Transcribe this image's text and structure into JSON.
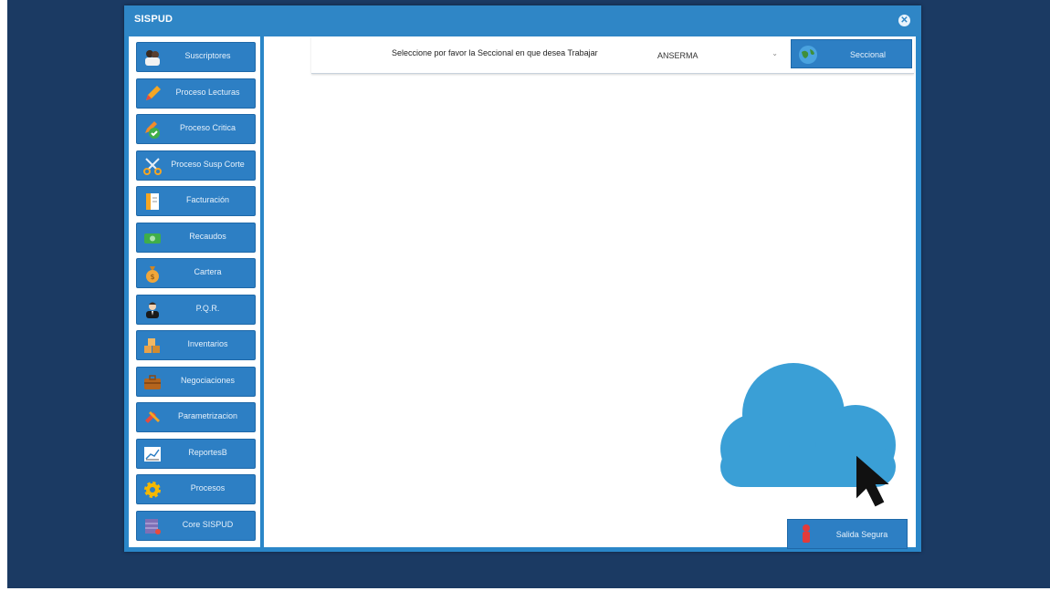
{
  "window": {
    "title": "SISPUD",
    "close_icon": "close-icon"
  },
  "sidebar": {
    "items": [
      {
        "label": "Suscriptores",
        "icon": "users-icon"
      },
      {
        "label": "Proceso Lecturas",
        "icon": "pencil-icon"
      },
      {
        "label": "Proceso Critica",
        "icon": "edit-check-icon"
      },
      {
        "label": "Proceso Susp Corte",
        "icon": "scissors-icon"
      },
      {
        "label": "Facturación",
        "icon": "invoice-icon"
      },
      {
        "label": "Recaudos",
        "icon": "cash-icon"
      },
      {
        "label": "Cartera",
        "icon": "money-bag-icon"
      },
      {
        "label": "P.Q.R.",
        "icon": "support-agent-icon"
      },
      {
        "label": "Inventarios",
        "icon": "boxes-icon"
      },
      {
        "label": "Negociaciones",
        "icon": "briefcase-icon"
      },
      {
        "label": "Parametrizacion",
        "icon": "tools-icon"
      },
      {
        "label": "ReportesB",
        "icon": "chart-icon"
      },
      {
        "label": "Procesos",
        "icon": "gear-icon"
      },
      {
        "label": "Core SISPUD",
        "icon": "database-icon"
      }
    ]
  },
  "header": {
    "prompt": "Seleccione por favor la Seccional en que desea Trabajar",
    "seccional_value": "ANSERMA",
    "seccional_button": "Seccional",
    "seccional_icon": "globe-icon"
  },
  "footer": {
    "exit_button": "Salida Segura",
    "exit_icon": "person-exit-icon"
  },
  "colors": {
    "backdrop": "#1b3a63",
    "window_blue": "#2a86c8",
    "button_blue": "#2d7fc4",
    "cloud": "#3a9fd6"
  }
}
